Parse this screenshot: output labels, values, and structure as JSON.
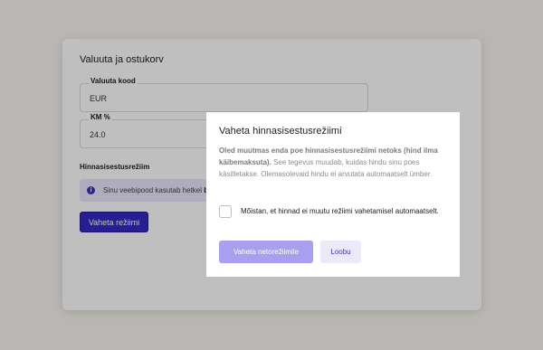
{
  "card": {
    "title": "Valuuta ja ostukorv",
    "currency_label": "Valuuta kood",
    "currency_value": "EUR",
    "vat_label": "KM %",
    "vat_value": "24.0",
    "section_title": "Hinnasisestusrežiim",
    "info_text": "Sinu veebipood kasutab hetkel",
    "info_bold": "bru",
    "switch_button": "Vaheta režiimi"
  },
  "modal": {
    "title": "Vaheta hinnasisestusrežiimi",
    "body_bold": "Oled muutmas enda poe hinnasisestusrežiimi netoks (hind ilma käibemaksuta).",
    "body_text": " See tegevus muudab, kuidas hindu sinu poes käsitletakse. Olemasolevaid hindu ei arvutata automaatselt ümber.",
    "checkbox_label": "Mõistan, et hinnad ei muutu režiimi vahetamisel automaatselt.",
    "checkbox_checked": false,
    "confirm_button": "Vaheta netorežiimile",
    "cancel_button": "Loobu"
  },
  "icons": {
    "info": "info-icon"
  }
}
